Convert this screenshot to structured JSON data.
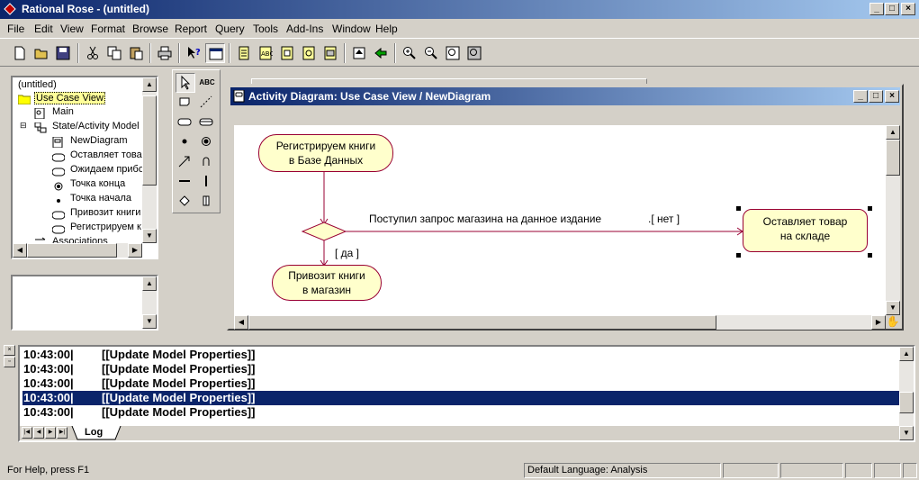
{
  "app": {
    "title": "Rational Rose - (untitled)"
  },
  "menu": [
    "File",
    "Edit",
    "View",
    "Format",
    "Browse",
    "Report",
    "Query",
    "Tools",
    "Add-Ins",
    "Window",
    "Help"
  ],
  "browser": {
    "items": [
      {
        "label": "(untitled)",
        "icon": "none"
      },
      {
        "label": "Use Case View",
        "icon": "folder-icon"
      },
      {
        "label": "Main",
        "icon": "diagram-icon"
      },
      {
        "label": "State/Activity Model",
        "icon": "state-model-icon"
      },
      {
        "label": "NewDiagram",
        "icon": "activity-diagram-icon"
      },
      {
        "label": "Оставляет товар",
        "icon": "activity-icon"
      },
      {
        "label": "Ожидаем прибо",
        "icon": "activity-icon"
      },
      {
        "label": "Точка конца",
        "icon": "end-state-icon"
      },
      {
        "label": "Точка начала",
        "icon": "start-state-icon"
      },
      {
        "label": "Привозит книги",
        "icon": "activity-icon"
      },
      {
        "label": "Регистрируем к",
        "icon": "activity-icon"
      },
      {
        "label": "Associations",
        "icon": "associations-icon"
      }
    ]
  },
  "diagram": {
    "title": "Activity Diagram: Use Case View / NewDiagram",
    "activities": {
      "register_line1": "Регистрируем книги",
      "register_line2": "в Базе Данных",
      "leave_line1": "Оставляет товар",
      "leave_line2": "на складе",
      "bring_line1": "Привозит книги",
      "bring_line2": "в магазин"
    },
    "transition_label": "Поступил запрос магазина на данное издание",
    "guard_no": ".[ нет ]",
    "guard_yes": "[ да ]"
  },
  "log": {
    "tab": "Log",
    "rows": [
      {
        "time": "10:43:00|",
        "text": "[[Update Model Properties]]",
        "selected": false
      },
      {
        "time": "10:43:00|",
        "text": "[[Update Model Properties]]",
        "selected": false
      },
      {
        "time": "10:43:00|",
        "text": "[[Update Model Properties]]",
        "selected": false
      },
      {
        "time": "10:43:00|",
        "text": "[[Update Model Properties]]",
        "selected": true
      },
      {
        "time": "10:43:00|",
        "text": "[[Update Model Properties]]",
        "selected": false
      }
    ]
  },
  "status": {
    "help": "For Help, press F1",
    "language": "Default Language: Analysis"
  },
  "colors": {
    "titlebar": "#0a246a",
    "activity_fill": "#ffffcc",
    "activity_border": "#990033",
    "selection": "#0a246a"
  }
}
